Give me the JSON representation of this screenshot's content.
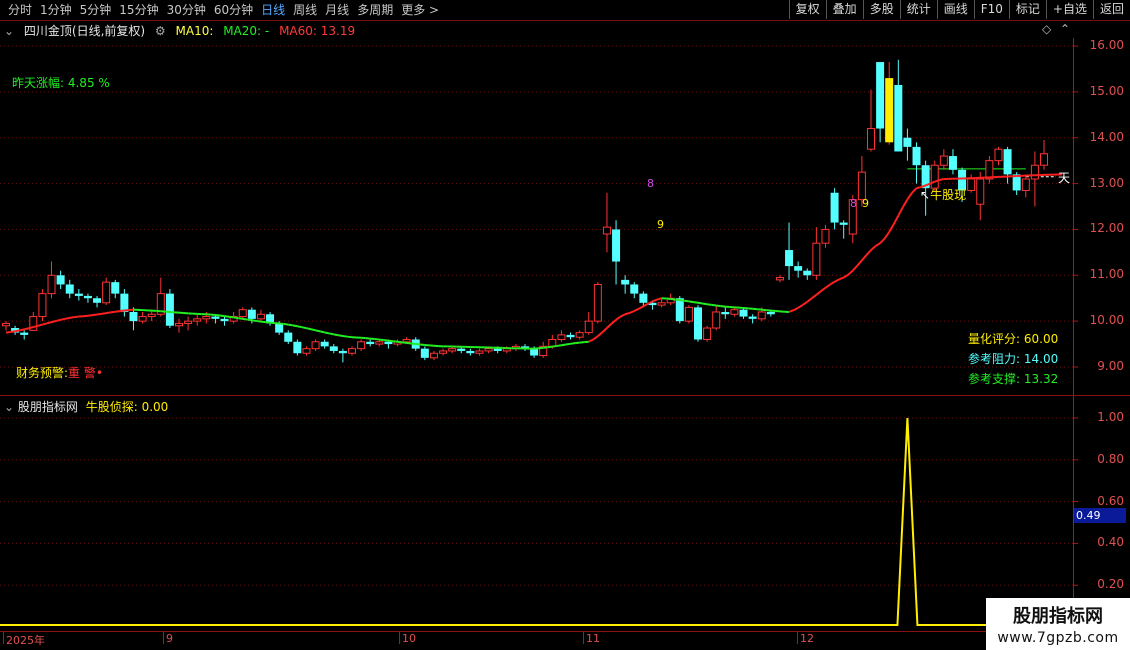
{
  "toolbar": {
    "periods": [
      "分时",
      "1分钟",
      "5分钟",
      "15分钟",
      "30分钟",
      "60分钟",
      "日线",
      "周线",
      "月线",
      "多周期",
      "更多 >"
    ],
    "active_period": "日线",
    "right_buttons": [
      "复权",
      "叠加",
      "多股",
      "统计",
      "画线",
      "F10",
      "标记",
      "+自选",
      "返回"
    ]
  },
  "header": {
    "title": "四川金顶(日线,前复权)",
    "ma10": "MA10: ",
    "ma20": "MA20: -",
    "ma60": "MA60: 13.19"
  },
  "main": {
    "yesterday_change": "昨天涨幅: 4.85 %",
    "finance_warning": "财务预警:",
    "finance_warning_value": "重 警",
    "signal_label": "牛股现",
    "signal_right_label": "天",
    "digit_8_a": "8",
    "digit_9_a": "9",
    "digit_8_b": "8",
    "digit_9_b": "9",
    "quant_score": "量化评分: 60.00",
    "resistance": "参考阻力: 14.00",
    "support": "参考支撑: 13.32",
    "price_ticks": [
      "16.00",
      "15.00",
      "14.00",
      "13.00",
      "12.00",
      "11.00",
      "10.00",
      "9.00"
    ]
  },
  "indicator": {
    "source": "股朋指标网",
    "name": "牛股侦探: 0.00",
    "ticks": [
      "1.00",
      "0.80",
      "0.60",
      "0.40",
      "0.20"
    ],
    "current_value": "0.49"
  },
  "date_axis": [
    "2025年",
    "9",
    "10",
    "11",
    "12"
  ],
  "watermark": {
    "line1": "股朋指标网",
    "line2": "www.7gpzb.com"
  },
  "colors": {
    "up": "#ff3333",
    "down": "#54ffff",
    "ma_red": "#ff2020",
    "ma_green": "#22ee22",
    "signal": "#ffee00",
    "grid": "#6b1010"
  },
  "chart_data": {
    "type": "candlestick",
    "ylim": [
      8.6,
      16.4
    ],
    "candles": [
      [
        9.9,
        9.95,
        9.8,
        10.0
      ],
      [
        9.85,
        9.75,
        9.7,
        9.9
      ],
      [
        9.75,
        9.7,
        9.6,
        9.8
      ],
      [
        9.8,
        10.1,
        9.8,
        10.2
      ],
      [
        10.1,
        10.6,
        10.0,
        10.7
      ],
      [
        10.6,
        11.0,
        10.5,
        11.3
      ],
      [
        11.0,
        10.8,
        10.7,
        11.1
      ],
      [
        10.8,
        10.6,
        10.5,
        10.9
      ],
      [
        10.6,
        10.55,
        10.45,
        10.7
      ],
      [
        10.55,
        10.5,
        10.4,
        10.6
      ],
      [
        10.5,
        10.4,
        10.3,
        10.55
      ],
      [
        10.4,
        10.85,
        10.35,
        10.95
      ],
      [
        10.85,
        10.6,
        10.5,
        10.9
      ],
      [
        10.6,
        10.2,
        10.1,
        10.7
      ],
      [
        10.2,
        10.0,
        9.8,
        10.3
      ],
      [
        10.0,
        10.1,
        9.95,
        10.2
      ],
      [
        10.1,
        10.15,
        10.0,
        10.25
      ],
      [
        10.15,
        10.6,
        10.1,
        10.95
      ],
      [
        10.6,
        9.9,
        9.85,
        10.7
      ],
      [
        9.9,
        9.95,
        9.75,
        10.05
      ],
      [
        9.95,
        10.0,
        9.8,
        10.1
      ],
      [
        10.0,
        10.05,
        9.9,
        10.15
      ],
      [
        10.05,
        10.1,
        9.95,
        10.2
      ],
      [
        10.1,
        10.05,
        9.95,
        10.15
      ],
      [
        10.05,
        10.0,
        9.9,
        10.1
      ],
      [
        10.0,
        10.1,
        9.95,
        10.2
      ],
      [
        10.1,
        10.25,
        10.05,
        10.3
      ],
      [
        10.25,
        10.05,
        9.95,
        10.3
      ],
      [
        10.05,
        10.15,
        10.0,
        10.25
      ],
      [
        10.15,
        9.95,
        9.9,
        10.2
      ],
      [
        9.95,
        9.75,
        9.7,
        10.0
      ],
      [
        9.75,
        9.55,
        9.5,
        9.8
      ],
      [
        9.55,
        9.3,
        9.25,
        9.6
      ],
      [
        9.3,
        9.4,
        9.25,
        9.45
      ],
      [
        9.4,
        9.55,
        9.35,
        9.6
      ],
      [
        9.55,
        9.45,
        9.4,
        9.6
      ],
      [
        9.45,
        9.35,
        9.3,
        9.5
      ],
      [
        9.35,
        9.3,
        9.1,
        9.4
      ],
      [
        9.3,
        9.4,
        9.25,
        9.45
      ],
      [
        9.4,
        9.55,
        9.35,
        9.6
      ],
      [
        9.55,
        9.5,
        9.45,
        9.6
      ],
      [
        9.5,
        9.55,
        9.45,
        9.6
      ],
      [
        9.55,
        9.5,
        9.4,
        9.6
      ],
      [
        9.5,
        9.55,
        9.45,
        9.6
      ],
      [
        9.55,
        9.6,
        9.5,
        9.65
      ],
      [
        9.6,
        9.4,
        9.35,
        9.65
      ],
      [
        9.4,
        9.2,
        9.15,
        9.45
      ],
      [
        9.2,
        9.3,
        9.15,
        9.35
      ],
      [
        9.3,
        9.35,
        9.25,
        9.4
      ],
      [
        9.35,
        9.4,
        9.3,
        9.45
      ],
      [
        9.4,
        9.35,
        9.3,
        9.45
      ],
      [
        9.35,
        9.3,
        9.25,
        9.4
      ],
      [
        9.3,
        9.35,
        9.25,
        9.4
      ],
      [
        9.35,
        9.4,
        9.3,
        9.45
      ],
      [
        9.4,
        9.35,
        9.3,
        9.45
      ],
      [
        9.35,
        9.4,
        9.3,
        9.45
      ],
      [
        9.4,
        9.45,
        9.35,
        9.5
      ],
      [
        9.45,
        9.4,
        9.35,
        9.5
      ],
      [
        9.4,
        9.25,
        9.2,
        9.45
      ],
      [
        9.25,
        9.45,
        9.2,
        9.55
      ],
      [
        9.45,
        9.6,
        9.4,
        9.7
      ],
      [
        9.6,
        9.7,
        9.55,
        9.8
      ],
      [
        9.7,
        9.65,
        9.6,
        9.75
      ],
      [
        9.65,
        9.75,
        9.6,
        9.8
      ],
      [
        9.75,
        10.0,
        9.7,
        10.2
      ],
      [
        10.0,
        10.8,
        9.95,
        10.85
      ],
      [
        11.9,
        12.05,
        11.5,
        12.8
      ],
      [
        12.0,
        11.3,
        10.8,
        12.2
      ],
      [
        10.9,
        10.8,
        10.6,
        11.0
      ],
      [
        10.8,
        10.6,
        10.5,
        10.85
      ],
      [
        10.6,
        10.4,
        10.3,
        10.65
      ],
      [
        10.4,
        10.35,
        10.25,
        10.45
      ],
      [
        10.35,
        10.4,
        10.3,
        10.5
      ],
      [
        10.4,
        10.5,
        10.35,
        10.6
      ],
      [
        10.5,
        10.0,
        9.95,
        10.55
      ],
      [
        10.0,
        10.3,
        9.95,
        10.35
      ],
      [
        10.3,
        9.6,
        9.55,
        10.35
      ],
      [
        9.6,
        9.85,
        9.55,
        9.9
      ],
      [
        9.85,
        10.2,
        9.8,
        10.35
      ],
      [
        10.2,
        10.15,
        10.05,
        10.3
      ],
      [
        10.15,
        10.25,
        10.1,
        10.3
      ],
      [
        10.25,
        10.1,
        10.05,
        10.3
      ],
      [
        10.1,
        10.05,
        9.95,
        10.15
      ],
      [
        10.05,
        10.2,
        10.0,
        10.3
      ],
      [
        10.2,
        10.15,
        10.1,
        10.25
      ],
      [
        10.9,
        10.95,
        10.85,
        11.0
      ],
      [
        11.55,
        11.2,
        10.9,
        12.15
      ],
      [
        11.2,
        11.1,
        10.95,
        11.3
      ],
      [
        11.1,
        11.0,
        10.9,
        11.15
      ],
      [
        11.0,
        11.7,
        10.9,
        12.05
      ],
      [
        11.7,
        12.0,
        11.6,
        12.1
      ],
      [
        12.8,
        12.15,
        12.0,
        12.9
      ],
      [
        12.15,
        12.1,
        11.8,
        12.2
      ],
      [
        11.9,
        12.65,
        11.7,
        12.75
      ],
      [
        12.65,
        13.25,
        12.5,
        13.6
      ],
      [
        13.75,
        14.2,
        13.7,
        15.05
      ],
      [
        15.65,
        14.2,
        13.9,
        15.65
      ],
      [
        13.95,
        14.4,
        13.85,
        15.65
      ],
      [
        15.15,
        13.7,
        13.7,
        15.7
      ],
      [
        14.0,
        13.8,
        13.5,
        14.2
      ],
      [
        13.8,
        13.4,
        13.0,
        13.9
      ],
      [
        13.4,
        12.9,
        12.3,
        13.5
      ],
      [
        12.9,
        13.4,
        12.85,
        13.5
      ],
      [
        13.4,
        13.6,
        13.3,
        13.75
      ],
      [
        13.6,
        13.3,
        13.2,
        13.75
      ],
      [
        13.3,
        12.85,
        12.6,
        13.35
      ],
      [
        12.85,
        13.1,
        12.8,
        13.2
      ],
      [
        12.55,
        13.1,
        12.2,
        13.25
      ],
      [
        13.1,
        13.5,
        13.0,
        13.6
      ],
      [
        13.5,
        13.75,
        13.4,
        13.8
      ],
      [
        13.75,
        13.2,
        13.0,
        13.8
      ],
      [
        13.2,
        12.85,
        12.75,
        13.25
      ],
      [
        12.85,
        13.1,
        12.7,
        13.2
      ],
      [
        13.1,
        13.4,
        12.5,
        13.7
      ],
      [
        13.4,
        13.65,
        13.3,
        13.95
      ]
    ],
    "ma60_line": [
      [
        0,
        9.75
      ],
      [
        8,
        10.1
      ],
      [
        14,
        10.25
      ],
      [
        22,
        10.15
      ],
      [
        30,
        9.95
      ],
      [
        38,
        9.65
      ],
      [
        48,
        9.45
      ],
      [
        58,
        9.4
      ],
      [
        64,
        9.55
      ],
      [
        68,
        10.15
      ],
      [
        72,
        10.5
      ],
      [
        80,
        10.3
      ],
      [
        86,
        10.2
      ],
      [
        92,
        10.95
      ],
      [
        96,
        11.7
      ],
      [
        100,
        12.9
      ],
      [
        103,
        13.1
      ],
      [
        116,
        13.2
      ]
    ],
    "ma60_green_ranges": [
      [
        14,
        64
      ],
      [
        72,
        86
      ]
    ],
    "indicator_series": {
      "ylim": [
        0,
        1.05
      ],
      "pulse_index": 99,
      "pulse_value": 1.0
    }
  }
}
